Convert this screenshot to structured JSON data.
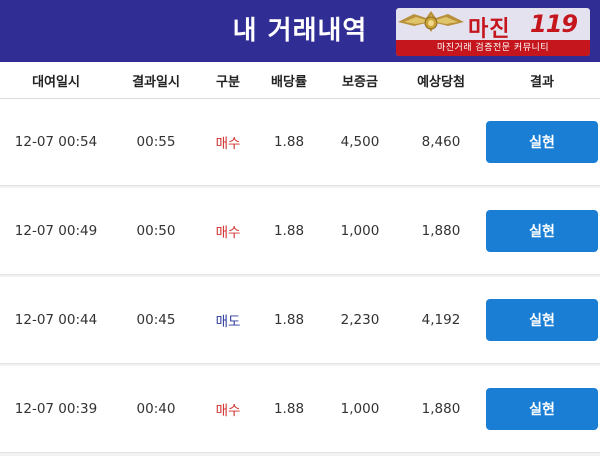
{
  "header": {
    "title": "내 거래내역"
  },
  "logo": {
    "main_text": "마진",
    "number_text": "119",
    "sub_text": "마진거래 검증전문 커뮤니티",
    "colors": {
      "red": "#c4161c",
      "gold": "#c9a23a"
    }
  },
  "columns": [
    "대여일시",
    "결과일시",
    "구분",
    "배당률",
    "보증금",
    "예상당첨",
    "결과"
  ],
  "rows": [
    {
      "rent_time": "12-07 00:54",
      "result_time": "00:55",
      "type": "매수",
      "type_kind": "buy",
      "rate": "1.88",
      "deposit": "4,500",
      "expected": "8,460",
      "result": "실현"
    },
    {
      "rent_time": "12-07 00:49",
      "result_time": "00:50",
      "type": "매수",
      "type_kind": "buy",
      "rate": "1.88",
      "deposit": "1,000",
      "expected": "1,880",
      "result": "실현"
    },
    {
      "rent_time": "12-07 00:44",
      "result_time": "00:45",
      "type": "매도",
      "type_kind": "sell",
      "rate": "1.88",
      "deposit": "2,230",
      "expected": "4,192",
      "result": "실현"
    },
    {
      "rent_time": "12-07 00:39",
      "result_time": "00:40",
      "type": "매수",
      "type_kind": "buy",
      "rate": "1.88",
      "deposit": "1,000",
      "expected": "1,880",
      "result": "실현"
    }
  ],
  "colors": {
    "header_bg": "#302e94",
    "buy": "#d0312d",
    "sell": "#2d3a9e",
    "button": "#1a7fd4"
  }
}
